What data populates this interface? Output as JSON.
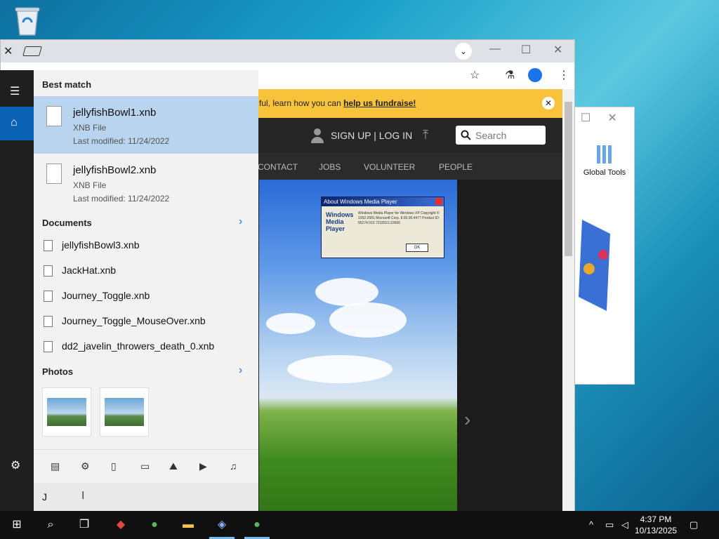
{
  "browser": {
    "banner_text": "ful, learn how you can ",
    "banner_link": "help us fundraise!",
    "header": {
      "signup": "SIGN UP | LOG IN",
      "search_placeholder": "Search"
    },
    "menu": [
      "CONTACT",
      "JOBS",
      "VOLUNTEER",
      "PEOPLE"
    ],
    "dialog": {
      "title": "About Windows Media Player",
      "logo": "Windows Media Player",
      "text": "Windows Media Player for Windows XP Copyright © 1992-2001 Microsoft Corp. 8.00.00.4477 Product ID: 55274 015 7215521-23656",
      "ok": "OK"
    }
  },
  "side_app": {
    "tool_label": "Global Tools"
  },
  "search_panel": {
    "best_match_title": "Best match",
    "best_match": [
      {
        "name": "jellyfishBowl1.xnb",
        "type": "XNB File",
        "modified": "Last modified: 11/24/2022"
      },
      {
        "name": "jellyfishBowl2.xnb",
        "type": "XNB File",
        "modified": "Last modified: 11/24/2022"
      }
    ],
    "documents_title": "Documents",
    "documents": [
      "jellyfishBowl3.xnb",
      "JackHat.xnb",
      "Journey_Toggle.xnb",
      "Journey_Toggle_MouseOver.xnb",
      "dd2_javelin_throwers_death_0.xnb"
    ],
    "photos_title": "Photos",
    "query": "J"
  },
  "taskbar": {
    "time": "4:37 PM",
    "date": "10/13/2025"
  }
}
